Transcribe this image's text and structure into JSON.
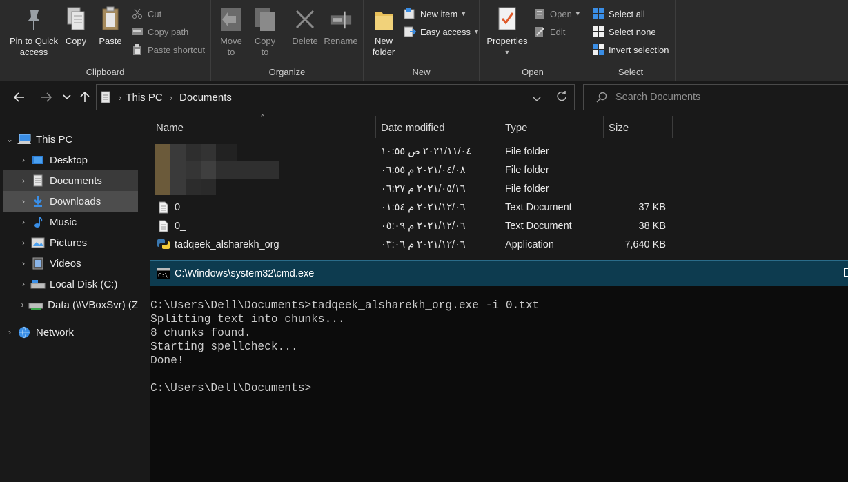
{
  "ribbon": {
    "clipboard": {
      "label": "Clipboard",
      "pin": "Pin to Quick\naccess",
      "copy": "Copy",
      "paste": "Paste",
      "cut": "Cut",
      "copy_path": "Copy path",
      "paste_shortcut": "Paste shortcut"
    },
    "organize": {
      "label": "Organize",
      "move_to": "Move\nto",
      "copy_to": "Copy\nto",
      "delete": "Delete",
      "rename": "Rename"
    },
    "new": {
      "label": "New",
      "new_folder": "New\nfolder",
      "new_item": "New item",
      "easy_access": "Easy access"
    },
    "open": {
      "label": "Open",
      "properties": "Properties",
      "open": "Open",
      "edit": "Edit"
    },
    "select": {
      "label": "Select",
      "select_all": "Select all",
      "select_none": "Select none",
      "invert_selection": "Invert selection"
    }
  },
  "address": {
    "crumbs": [
      "This PC",
      "Documents"
    ],
    "search_placeholder": "Search Documents"
  },
  "sidebar": {
    "items": [
      {
        "label": "This PC",
        "icon": "this-pc-icon"
      },
      {
        "label": "Desktop",
        "icon": "desktop-icon"
      },
      {
        "label": "Documents",
        "icon": "documents-icon"
      },
      {
        "label": "Downloads",
        "icon": "downloads-icon"
      },
      {
        "label": "Music",
        "icon": "music-icon"
      },
      {
        "label": "Pictures",
        "icon": "pictures-icon"
      },
      {
        "label": "Videos",
        "icon": "videos-icon"
      },
      {
        "label": "Local Disk (C:)",
        "icon": "local-disk-icon"
      },
      {
        "label": "Data (\\\\VBoxSvr) (Z",
        "icon": "network-drive-icon"
      },
      {
        "label": "Network",
        "icon": "network-icon"
      }
    ]
  },
  "filelist": {
    "columns": [
      "Name",
      "Date modified",
      "Type",
      "Size"
    ],
    "rows": [
      {
        "name": "",
        "date": "٢٠٢١/١١/٠٤ ص ١٠:٥٥",
        "type": "File folder",
        "size": ""
      },
      {
        "name": "",
        "date": "٢٠٢١/٠٤/٠٨ م ٠٦:٥٥",
        "type": "File folder",
        "size": ""
      },
      {
        "name": "",
        "date": "٢٠٢١/٠٥/١٦ م ٠٦:٢٧",
        "type": "File folder",
        "size": ""
      },
      {
        "name": "0",
        "date": "٢٠٢١/١٢/٠٦ م ٠١:٥٤",
        "type": "Text Document",
        "size": "37 KB"
      },
      {
        "name": "0_",
        "date": "٢٠٢١/١٢/٠٦ م ٠٥:٠٩",
        "type": "Text Document",
        "size": "38 KB"
      },
      {
        "name": "tadqeek_alsharekh_org",
        "date": "٢٠٢١/١٢/٠٦ م ٠٣:٠٦",
        "type": "Application",
        "size": "7,640 KB"
      }
    ]
  },
  "console": {
    "title": "C:\\Windows\\system32\\cmd.exe",
    "lines": [
      "C:\\Users\\Dell\\Documents>tadqeek_alsharekh_org.exe -i 0.txt",
      "Splitting text into chunks...",
      "8 chunks found.",
      "Starting spellcheck...",
      "Done!",
      "",
      "C:\\Users\\Dell\\Documents>"
    ]
  },
  "colors": {
    "ribbon_bg": "#2b2b2b",
    "window_bg": "#191919",
    "console_title_bg": "#0d3b4f",
    "console_bg": "#0c0c0c",
    "accent_blue": "#3a8ee6",
    "folder_yellow": "#e8c05a"
  }
}
